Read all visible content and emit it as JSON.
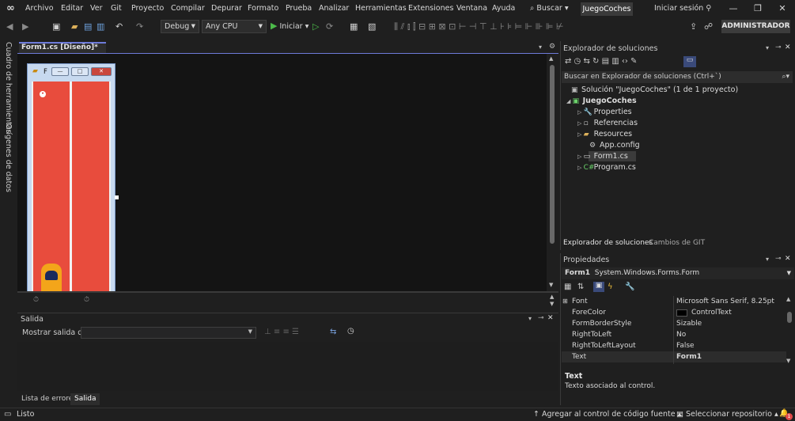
{
  "menubar": {
    "items": [
      "Archivo",
      "Editar",
      "Ver",
      "Git",
      "Proyecto",
      "Compilar",
      "Depurar",
      "Formato",
      "Prueba",
      "Analizar",
      "Herramientas",
      "Extensiones",
      "Ventana",
      "Ayuda"
    ],
    "search_label": "Buscar",
    "solution_name": "JuegoCoches",
    "signin_label": "Iniciar sesión"
  },
  "toolbar": {
    "config": "Debug",
    "platform": "Any CPU",
    "run_label": "Iniciar",
    "admin_label": "ADMINISTRADOR"
  },
  "left_strip": {
    "toolbox": "Cuadro de herramientas",
    "datasources": "Orígenes de datos"
  },
  "document": {
    "tab_label": "Form1.cs [Diseño]*",
    "form_caption": "F"
  },
  "output": {
    "title": "Salida",
    "show_from_label": "Mostrar salida de:",
    "tabs": [
      "Lista de errores",
      "Salida"
    ]
  },
  "solution_explorer": {
    "title": "Explorador de soluciones",
    "search_placeholder": "Buscar en Explorador de soluciones (Ctrl+`)",
    "tree": [
      {
        "label": "Solución \"JuegoCoches\" (1 de 1 proyecto)",
        "icon": "solution-icon"
      },
      {
        "label": "JuegoCoches",
        "icon": "csharp-project-icon"
      },
      {
        "label": "Properties",
        "icon": "wrench-icon"
      },
      {
        "label": "Referencias",
        "icon": "references-icon"
      },
      {
        "label": "Resources",
        "icon": "folder-icon"
      },
      {
        "label": "App.config",
        "icon": "config-file-icon"
      },
      {
        "label": "Form1.cs",
        "icon": "form-icon"
      },
      {
        "label": "Program.cs",
        "icon": "csharp-file-icon"
      }
    ],
    "bottom_tabs": [
      "Explorador de soluciones",
      "Cambios de GIT"
    ]
  },
  "properties": {
    "title": "Propiedades",
    "object_name": "Form1",
    "object_type": "System.Windows.Forms.Form",
    "rows": [
      {
        "name": "Font",
        "value": "Microsoft Sans Serif, 8.25pt"
      },
      {
        "name": "ForeColor",
        "value": "ControlText"
      },
      {
        "name": "FormBorderStyle",
        "value": "Sizable"
      },
      {
        "name": "RightToLeft",
        "value": "No"
      },
      {
        "name": "RightToLeftLayout",
        "value": "False"
      },
      {
        "name": "Text",
        "value": "Form1"
      }
    ],
    "desc_title": "Text",
    "desc_text": "Texto asociado al control."
  },
  "statusbar": {
    "ready": "Listo",
    "source_control": "Agregar al control de código fuente",
    "repo": "Seleccionar repositorio",
    "notifications": "1"
  },
  "colors": {
    "accent": "#6e7bd9",
    "road": "#e84c3d",
    "car": "#f3a51a",
    "run": "#4cbb4a"
  }
}
